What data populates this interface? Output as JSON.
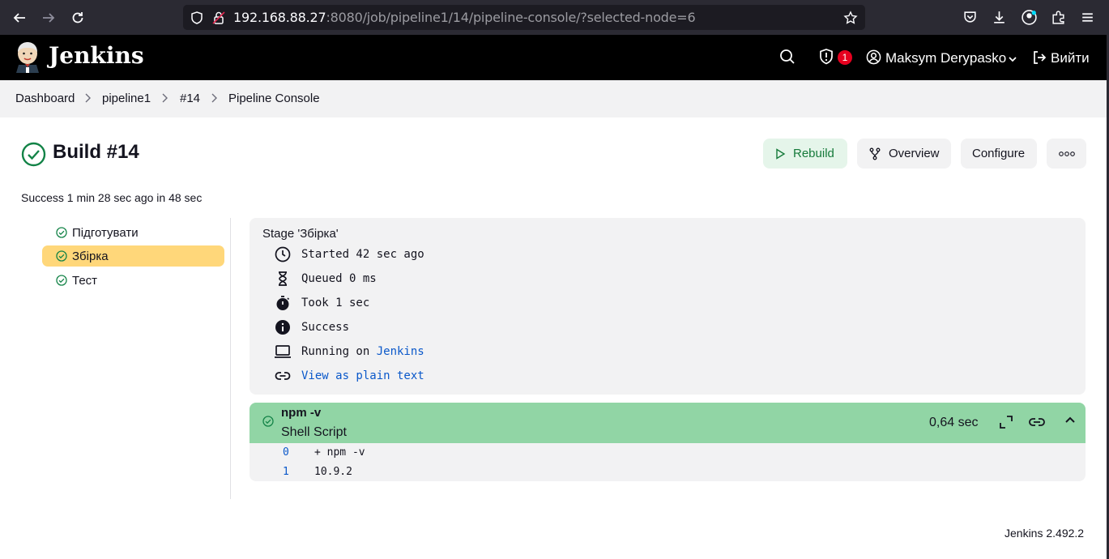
{
  "browser": {
    "url_host": "192.168.88.27",
    "url_rest": ":8080/job/pipeline1/14/pipeline-console/?selected-node=6",
    "icons": [
      "back-icon",
      "forward-icon",
      "reload-icon",
      "shield-icon",
      "insecure-lock-icon",
      "bookmark-star-icon",
      "pocket-icon",
      "download-icon",
      "account-icon",
      "extensions-icon",
      "menu-icon"
    ]
  },
  "header": {
    "brand": "Jenkins",
    "security_count": "1",
    "user_name": "Maksym Derypasko",
    "logout_label": "Вийти"
  },
  "breadcrumbs": [
    "Dashboard",
    "pipeline1",
    "#14",
    "Pipeline Console"
  ],
  "build": {
    "title": "Build #14",
    "status_line": "Success 1 min 28 sec ago in 48 sec",
    "buttons": {
      "rebuild": "Rebuild",
      "overview": "Overview",
      "configure": "Configure"
    }
  },
  "stages": [
    {
      "label": "Підготувати",
      "selected": false
    },
    {
      "label": "Збірка",
      "selected": true
    },
    {
      "label": "Тест",
      "selected": false
    }
  ],
  "stage_detail": {
    "title": "Stage 'Збірка'",
    "started": "Started 42 sec ago",
    "queued": "Queued 0 ms",
    "took": "Took 1 sec",
    "result": "Success",
    "running_prefix": "Running on ",
    "running_node": "Jenkins",
    "plain_text_link": "View as plain text"
  },
  "step": {
    "name": "npm -v",
    "type": "Shell Script",
    "duration": "0,64 sec",
    "log": [
      {
        "num": "0",
        "text": "+ npm -v"
      },
      {
        "num": "1",
        "text": "10.9.2"
      }
    ]
  },
  "footer": {
    "version": "Jenkins 2.492.2"
  },
  "colors": {
    "success": "#138347",
    "selected_stage": "#ffd77a",
    "step_header": "#91d5a5",
    "link": "#0a58ca"
  }
}
